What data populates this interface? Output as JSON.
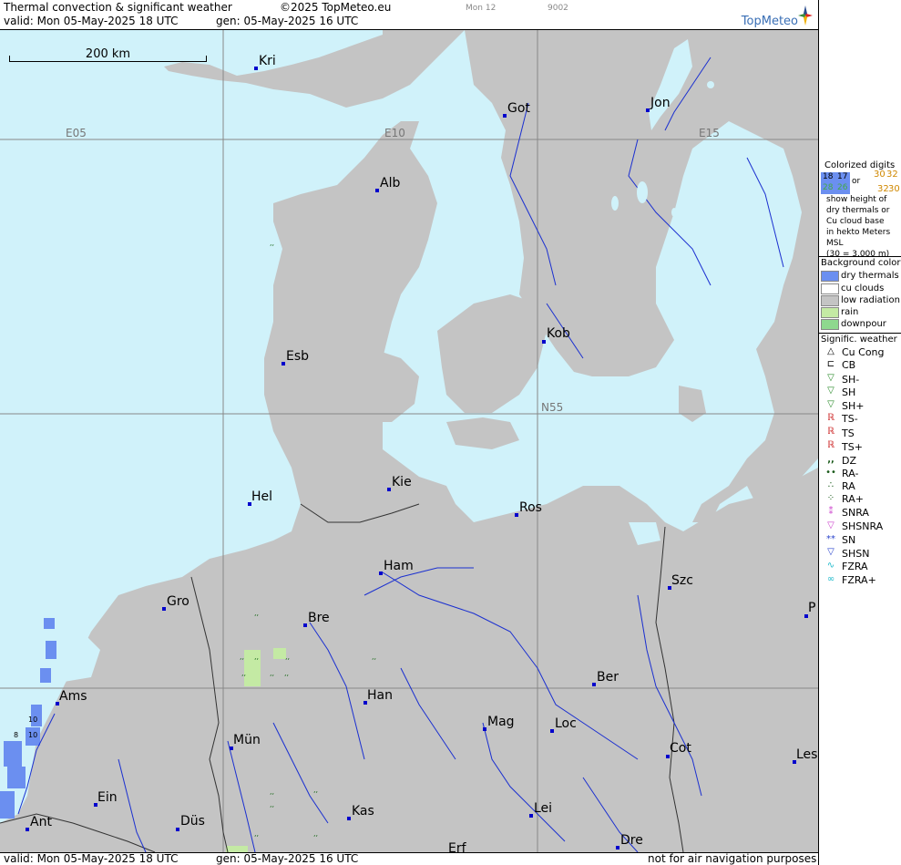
{
  "header": {
    "title": "Thermal convection & significant weather",
    "copyright": "©2025 TopMeteo.eu",
    "day_code": "Mon 12",
    "run_code": "9002",
    "valid": "valid:  Mon  05-May-2025  18 UTC",
    "gen": "gen: 05-May-2025 16 UTC",
    "logo": "TopMeteo"
  },
  "scale": {
    "label": "200 km"
  },
  "grid_labels": {
    "e05": "E05",
    "e10": "E10",
    "e15": "E15",
    "n55": "N55"
  },
  "cities": [
    {
      "code": "Kri"
    },
    {
      "code": "Got"
    },
    {
      "code": "Jon"
    },
    {
      "code": "Alb"
    },
    {
      "code": "Esb"
    },
    {
      "code": "Kob"
    },
    {
      "code": "Kie"
    },
    {
      "code": "Hel"
    },
    {
      "code": "Ros"
    },
    {
      "code": "Ham"
    },
    {
      "code": "Szc"
    },
    {
      "code": "Gro"
    },
    {
      "code": "Bre"
    },
    {
      "code": "P"
    },
    {
      "code": "Ber"
    },
    {
      "code": "Ams"
    },
    {
      "code": "Han"
    },
    {
      "code": "Mag"
    },
    {
      "code": "Loc"
    },
    {
      "code": "Mün"
    },
    {
      "code": "Cot"
    },
    {
      "code": "Les"
    },
    {
      "code": "Ein"
    },
    {
      "code": "Kas"
    },
    {
      "code": "Lei"
    },
    {
      "code": "Ant"
    },
    {
      "code": "Düs"
    },
    {
      "code": "Dre"
    },
    {
      "code": "Erf"
    }
  ],
  "thermal_digits": [
    "10",
    "10",
    "8"
  ],
  "footer": {
    "valid": "valid:  Mon  05-May-2025  18 UTC",
    "gen": "gen: 05-May-2025 16 UTC",
    "disclaimer": "not for air navigation purposes"
  },
  "legend": {
    "colorized_digits": {
      "title": "Colorized digits",
      "sample_a1": "18",
      "sample_a2": "17",
      "sample_a3": "28",
      "sample_a4": "26",
      "or": "or",
      "sample_b1": "30",
      "sample_b2": "32",
      "sample_b3": "32",
      "sample_b4": "30",
      "line1": "show height of",
      "line2": "dry thermals or",
      "line3": "Cu cloud base",
      "line4": "in hekto Meters",
      "line5": "MSL",
      "line6": "(30 = 3.000 m)"
    },
    "background": {
      "title": "Background color",
      "items": [
        {
          "label": "dry thermals",
          "color": "#6b8ff0"
        },
        {
          "label": "cu clouds",
          "color": "#ffffff"
        },
        {
          "label": "low radiation",
          "color": "#c4c4c4"
        },
        {
          "label": "rain",
          "color": "#c4eaa4"
        },
        {
          "label": "downpour",
          "color": "#8ed88e"
        }
      ]
    },
    "weather": {
      "title": "Signific. weather",
      "items": [
        {
          "label": "Cu Cong",
          "icon": "cu-cong-icon"
        },
        {
          "label": "CB",
          "icon": "cb-icon"
        },
        {
          "label": "SH-",
          "icon": "shower-light-icon"
        },
        {
          "label": "SH",
          "icon": "shower-icon"
        },
        {
          "label": "SH+",
          "icon": "shower-heavy-icon"
        },
        {
          "label": "TS-",
          "icon": "thunderstorm-light-icon"
        },
        {
          "label": "TS",
          "icon": "thunderstorm-icon"
        },
        {
          "label": "TS+",
          "icon": "thunderstorm-heavy-icon"
        },
        {
          "label": "DZ",
          "icon": "drizzle-icon"
        },
        {
          "label": "RA-",
          "icon": "rain-light-icon"
        },
        {
          "label": "RA",
          "icon": "rain-icon"
        },
        {
          "label": "RA+",
          "icon": "rain-heavy-icon"
        },
        {
          "label": "SNRA",
          "icon": "snow-rain-icon"
        },
        {
          "label": "SHSNRA",
          "icon": "snow-rain-shower-icon"
        },
        {
          "label": "SN",
          "icon": "snow-icon"
        },
        {
          "label": "SHSN",
          "icon": "snow-shower-icon"
        },
        {
          "label": "FZRA",
          "icon": "freezing-rain-icon"
        },
        {
          "label": "FZRA+",
          "icon": "freezing-rain-heavy-icon"
        }
      ]
    }
  },
  "colors": {
    "sea": "#d0f2fa",
    "land": "#c4c4c4",
    "border": "#333333",
    "river": "#1a2fd0",
    "grid": "#888888",
    "dry_thermals": "#6b8ff0",
    "rain": "#c4eaa4"
  }
}
